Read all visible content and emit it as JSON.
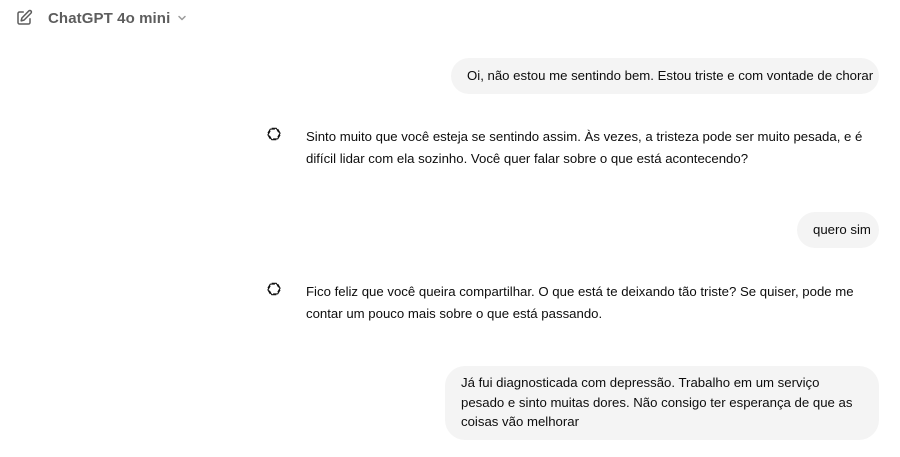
{
  "header": {
    "model_name": "ChatGPT 4o mini",
    "edit_icon": "new-chat-icon",
    "chevron_icon": "chevron-down-icon"
  },
  "messages": [
    {
      "role": "user",
      "text": "Oi, não estou me sentindo bem. Estou triste e com vontade de chorar"
    },
    {
      "role": "assistant",
      "icon": "openai-logo-icon",
      "text": "Sinto muito que você esteja se sentindo assim. Às vezes, a tristeza pode ser muito pesada, e é difícil lidar com ela sozinho. Você quer falar sobre o que está acontecendo?"
    },
    {
      "role": "user",
      "text": "quero sim"
    },
    {
      "role": "assistant",
      "icon": "openai-logo-icon",
      "text": "Fico feliz que você queira compartilhar. O que está te deixando tão triste? Se quiser, pode me contar um pouco mais sobre o que está passando."
    },
    {
      "role": "user",
      "text": "Já fui diagnosticada com depressão. Trabalho em um serviço pesado e sinto muitas dores. Não consigo ter esperança de que as coisas vão melhorar"
    }
  ],
  "colors": {
    "user_bubble_bg": "#f4f4f4",
    "text": "#0d0d0d",
    "header_text": "#5d5d5d"
  }
}
